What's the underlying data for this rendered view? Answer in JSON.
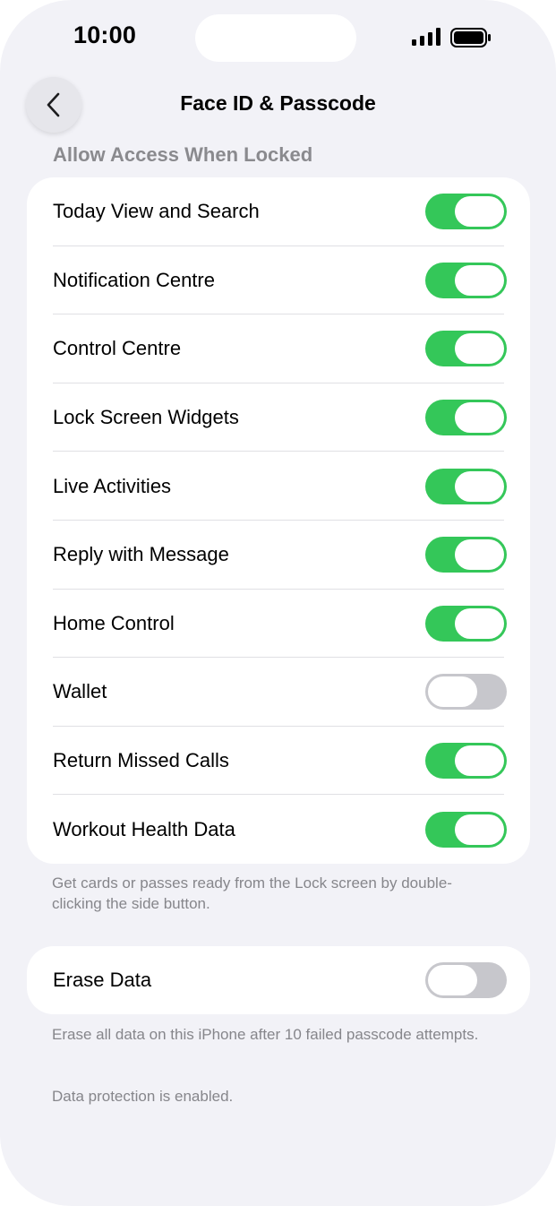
{
  "status_bar": {
    "time": "10:00"
  },
  "nav": {
    "title": "Face ID & Passcode",
    "back_icon": "chevron-left-icon"
  },
  "section": {
    "header": "Allow Access When Locked",
    "items": [
      {
        "label": "Today View and Search",
        "on": true
      },
      {
        "label": "Notification Centre",
        "on": true
      },
      {
        "label": "Control Centre",
        "on": true
      },
      {
        "label": "Lock Screen Widgets",
        "on": true
      },
      {
        "label": "Live Activities",
        "on": true
      },
      {
        "label": "Reply with Message",
        "on": true
      },
      {
        "label": "Home Control",
        "on": true
      },
      {
        "label": "Wallet",
        "on": false
      },
      {
        "label": "Return Missed Calls",
        "on": true
      },
      {
        "label": "Workout Health Data",
        "on": true
      }
    ],
    "footer": "Get cards or passes ready from the Lock screen by double-clicking the side button."
  },
  "erase": {
    "label": "Erase Data",
    "on": false,
    "footer": "Erase all data on this iPhone after 10 failed passcode attempts.",
    "note": "Data protection is enabled."
  },
  "colors": {
    "toggle_on": "#34c759",
    "toggle_off": "#c7c7cc",
    "background": "#f2f2f7"
  }
}
